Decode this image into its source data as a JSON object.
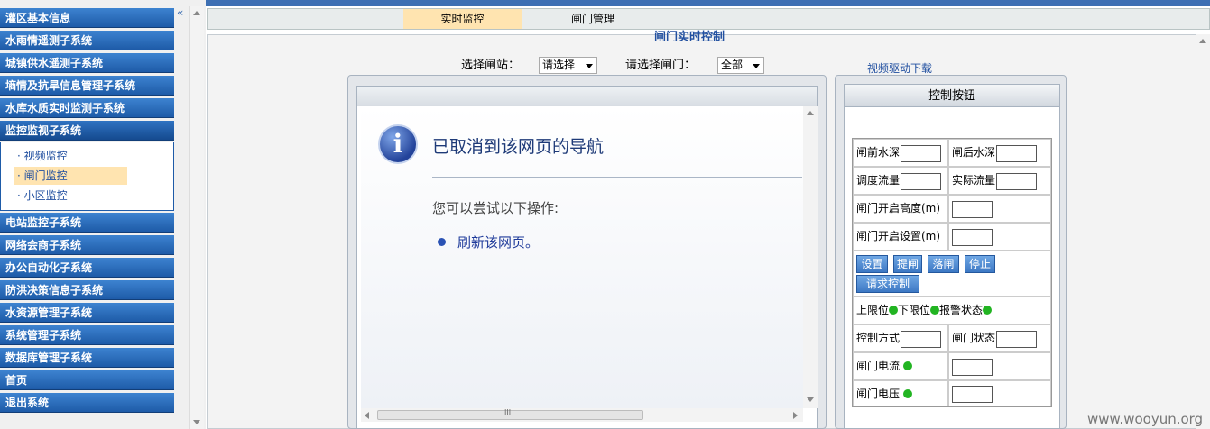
{
  "sidebar": {
    "collapse_glyph": "«",
    "items": [
      {
        "label": "灌区基本信息"
      },
      {
        "label": "水雨情遥测子系统"
      },
      {
        "label": "城镇供水遥测子系统"
      },
      {
        "label": "墒情及抗旱信息管理子系统"
      },
      {
        "label": "水库水质实时监测子系统"
      },
      {
        "label": "监控监视子系统"
      },
      {
        "label": "电站监控子系统"
      },
      {
        "label": "网络会商子系统"
      },
      {
        "label": "办公自动化子系统"
      },
      {
        "label": "防洪决策信息子系统"
      },
      {
        "label": "水资源管理子系统"
      },
      {
        "label": "系统管理子系统"
      },
      {
        "label": "数据库管理子系统"
      },
      {
        "label": "首页"
      },
      {
        "label": "退出系统"
      }
    ],
    "submenu": [
      {
        "label": "· 视频监控"
      },
      {
        "label": "· 闸门监控"
      },
      {
        "label": "· 小区监控"
      }
    ]
  },
  "tabs": [
    {
      "label": "实时监控"
    },
    {
      "label": "闸门管理"
    }
  ],
  "page": {
    "title": "闸门实时控制",
    "station_label": "选择闸站：",
    "station_value": "请选择",
    "gate_label": "请选择闸门：",
    "gate_value": "全部",
    "video_link": "视频驱动下载"
  },
  "browser_error": {
    "title": "已取消到该网页的导航",
    "try_text": "您可以尝试以下操作:",
    "refresh_link": "刷新该网页。",
    "scroll_grip": "III"
  },
  "control": {
    "header": "控制按钮",
    "front_depth": "闸前水深",
    "back_depth": "闸后水深",
    "dispatch_flow": "调度流量",
    "actual_flow": "实际流量",
    "open_height": "闸门开启高度(m)",
    "open_setting": "闸门开启设置(m)",
    "btn_set": "设置",
    "btn_lift": "提闸",
    "btn_drop": "落闸",
    "btn_stop": "停止",
    "btn_request": "请求控制",
    "upper_limit": "上限位",
    "lower_limit": "下限位",
    "alarm": "报警状态",
    "control_mode": "控制方式",
    "gate_status": "闸门状态",
    "gate_current": "闸门电流",
    "gate_voltage": "闸门电压",
    "led_color": "#22b422"
  },
  "watermark": "www.wooyun.org"
}
